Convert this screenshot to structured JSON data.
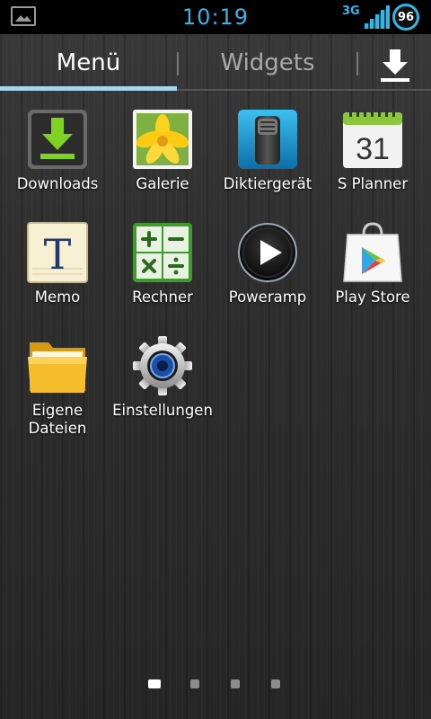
{
  "status_bar": {
    "time": "10:19",
    "network": "3G",
    "battery": "96",
    "icons": [
      "gallery-notification-icon",
      "signal-icon",
      "battery-icon"
    ]
  },
  "tabs": {
    "menu": "Menü",
    "widgets": "Widgets",
    "download_icon": "download-icon"
  },
  "apps": [
    {
      "label": "Downloads",
      "icon": "downloads-icon"
    },
    {
      "label": "Galerie",
      "icon": "gallery-icon"
    },
    {
      "label": "Diktiergerät",
      "icon": "voice-recorder-icon"
    },
    {
      "label": "S Planner",
      "icon": "calendar-icon",
      "day": "31"
    },
    {
      "label": "Memo",
      "icon": "memo-icon",
      "glyph": "T"
    },
    {
      "label": "Rechner",
      "icon": "calculator-icon"
    },
    {
      "label": "Poweramp",
      "icon": "poweramp-icon"
    },
    {
      "label": "Play Store",
      "icon": "play-store-icon"
    },
    {
      "label": "Eigene\nDateien",
      "icon": "folder-icon"
    },
    {
      "label": "Einstellungen",
      "icon": "settings-gear-icon"
    }
  ],
  "pages": {
    "count": 4,
    "active": 1
  },
  "colors": {
    "accent": "#33b5e5",
    "tab_indicator": "#a8d4ec"
  }
}
